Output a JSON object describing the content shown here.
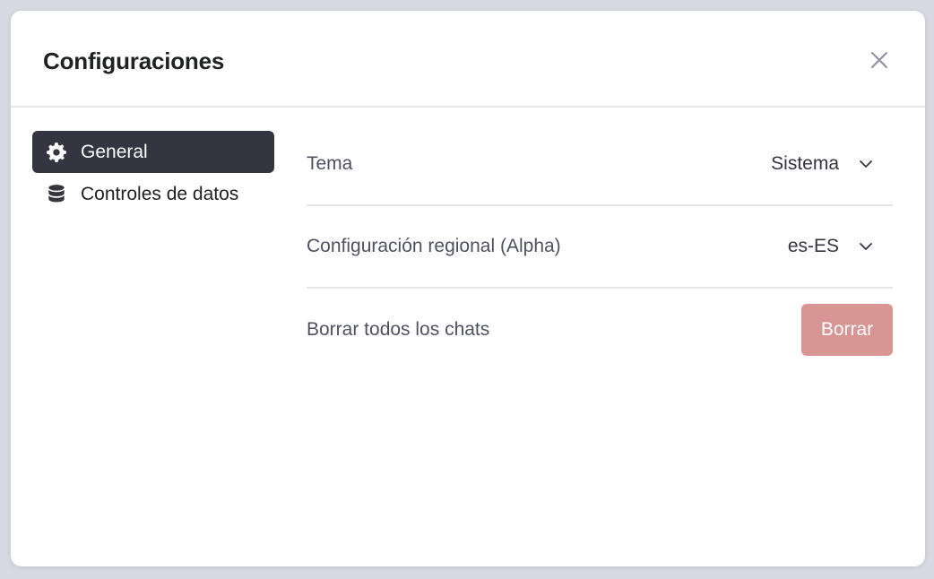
{
  "dialog": {
    "title": "Configuraciones",
    "close_icon": "close-icon"
  },
  "sidebar": {
    "items": [
      {
        "label": "General",
        "icon": "gear-icon",
        "active": true
      },
      {
        "label": "Controles de datos",
        "icon": "database-icon",
        "active": false
      }
    ]
  },
  "settings": {
    "theme": {
      "label": "Tema",
      "value": "Sistema"
    },
    "locale": {
      "label": "Configuración regional (Alpha)",
      "value": "es-ES"
    },
    "clear_chats": {
      "label": "Borrar todos los chats",
      "button_label": "Borrar"
    }
  },
  "colors": {
    "active_sidebar_bg": "#343541",
    "danger_button_bg": "#d99593",
    "backdrop": "#d9d9e3"
  }
}
